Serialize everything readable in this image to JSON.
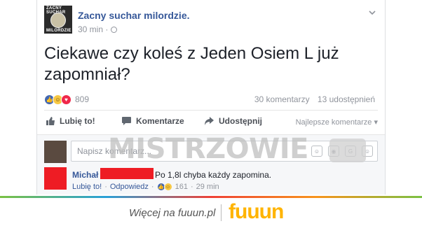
{
  "post": {
    "page_name": "Zacny suchar milordzie.",
    "avatar_text_top": "ZACNY SUCHAR",
    "avatar_text_bottom": "MILORDZIE",
    "time": "30 min ·",
    "text": "Ciekawe czy koleś z Jeden Osiem L już zapomniał?"
  },
  "reactions": {
    "count": "809",
    "comments": "30 komentarzy",
    "shares": "13 udostępnień"
  },
  "actions": {
    "like": "Lubię to!",
    "comment": "Komentarze",
    "share": "Udostępnij",
    "sort": "Najlepsze komentarze"
  },
  "comment_box": {
    "placeholder": "Napisz komentarz..."
  },
  "watermark": "MISTRZOWIE",
  "reply": {
    "name": "Michał",
    "text": "Po 1,8l chyba każdy zapomina.",
    "like": "Lubię to!",
    "reply": "Odpowiedz",
    "reaction_count": "161",
    "time": "29 min"
  },
  "footer": {
    "text": "Więcej na fuuun.pl",
    "logo": "fuuun"
  },
  "colors": {
    "link": "#365899",
    "like_blue": "#4267b2",
    "redaction": "#ee1c24",
    "logo_yellow": "#ffb400"
  }
}
